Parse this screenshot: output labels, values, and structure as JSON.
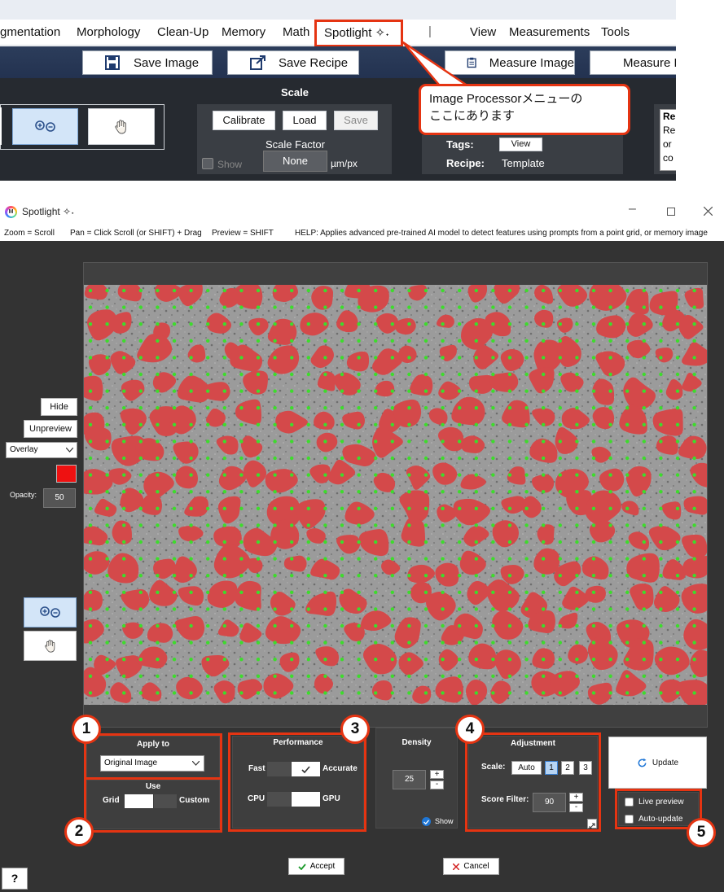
{
  "menu": {
    "items": [
      "gmentation",
      "Morphology",
      "Clean-Up",
      "Memory",
      "Math",
      "Spotlight ✧˖",
      "|",
      "View",
      "Measurements",
      "Tools"
    ]
  },
  "toolbar": {
    "save_image": "Save Image",
    "save_recipe": "Save Recipe",
    "measure_image": "Measure Image",
    "measure_f": "Measure F"
  },
  "ribbon": {
    "scale_title": "Scale",
    "calibrate": "Calibrate",
    "load": "Load",
    "save": "Save",
    "scale_factor_label": "Scale Factor",
    "scale_factor_value": "None",
    "unit": "µm/px",
    "show_label": "Show",
    "tags_label": "Tags:",
    "view_btn": "View",
    "recipe_label": "Recipe:",
    "recipe_value": "Template",
    "right_box": [
      "Re",
      "Re",
      "or",
      "co"
    ]
  },
  "callout": {
    "line1": "Image Processorメニューの",
    "line2": "ここにあります"
  },
  "window": {
    "title": "Spotlight ✧˖",
    "app_icon": "M",
    "help": {
      "zoom": "Zoom = Scroll",
      "pan": "Pan = Click Scroll (or SHIFT) + Drag",
      "preview": "Preview = SHIFT",
      "help": "HELP:  Applies advanced pre-trained AI model to detect features using prompts from a point grid, or memory image"
    }
  },
  "side": {
    "hide": "Hide",
    "unpreview": "Unpreview",
    "overlay_select": "Overlay",
    "overlay_color": "#ee1111",
    "opacity_label": "Opacity:",
    "opacity_value": "50"
  },
  "controls": {
    "apply_to_title": "Apply to",
    "apply_to_value": "Original Image",
    "use_title": "Use",
    "grid": "Grid",
    "custom": "Custom",
    "performance_title": "Performance",
    "fast": "Fast",
    "accurate": "Accurate",
    "cpu": "CPU",
    "gpu": "GPU",
    "density_title": "Density",
    "density_value": "25",
    "show": "Show",
    "adjustment_title": "Adjustment",
    "scale_label": "Scale:",
    "scale_options": [
      "Auto",
      "1",
      "2",
      "3"
    ],
    "score_filter_label": "Score Filter:",
    "score_filter_value": "90",
    "update": "Update",
    "live_preview": "Live preview",
    "auto_update": "Auto-update",
    "accept": "Accept",
    "cancel": "Cancel",
    "help_button": "?"
  },
  "badges": [
    "1",
    "2",
    "3",
    "4",
    "5"
  ],
  "colors": {
    "highlight": "#e53412",
    "toolbar_blue": "#2c3d5b",
    "overlay_red": "#d4494a",
    "grid_dot": "#3ddc2c"
  }
}
